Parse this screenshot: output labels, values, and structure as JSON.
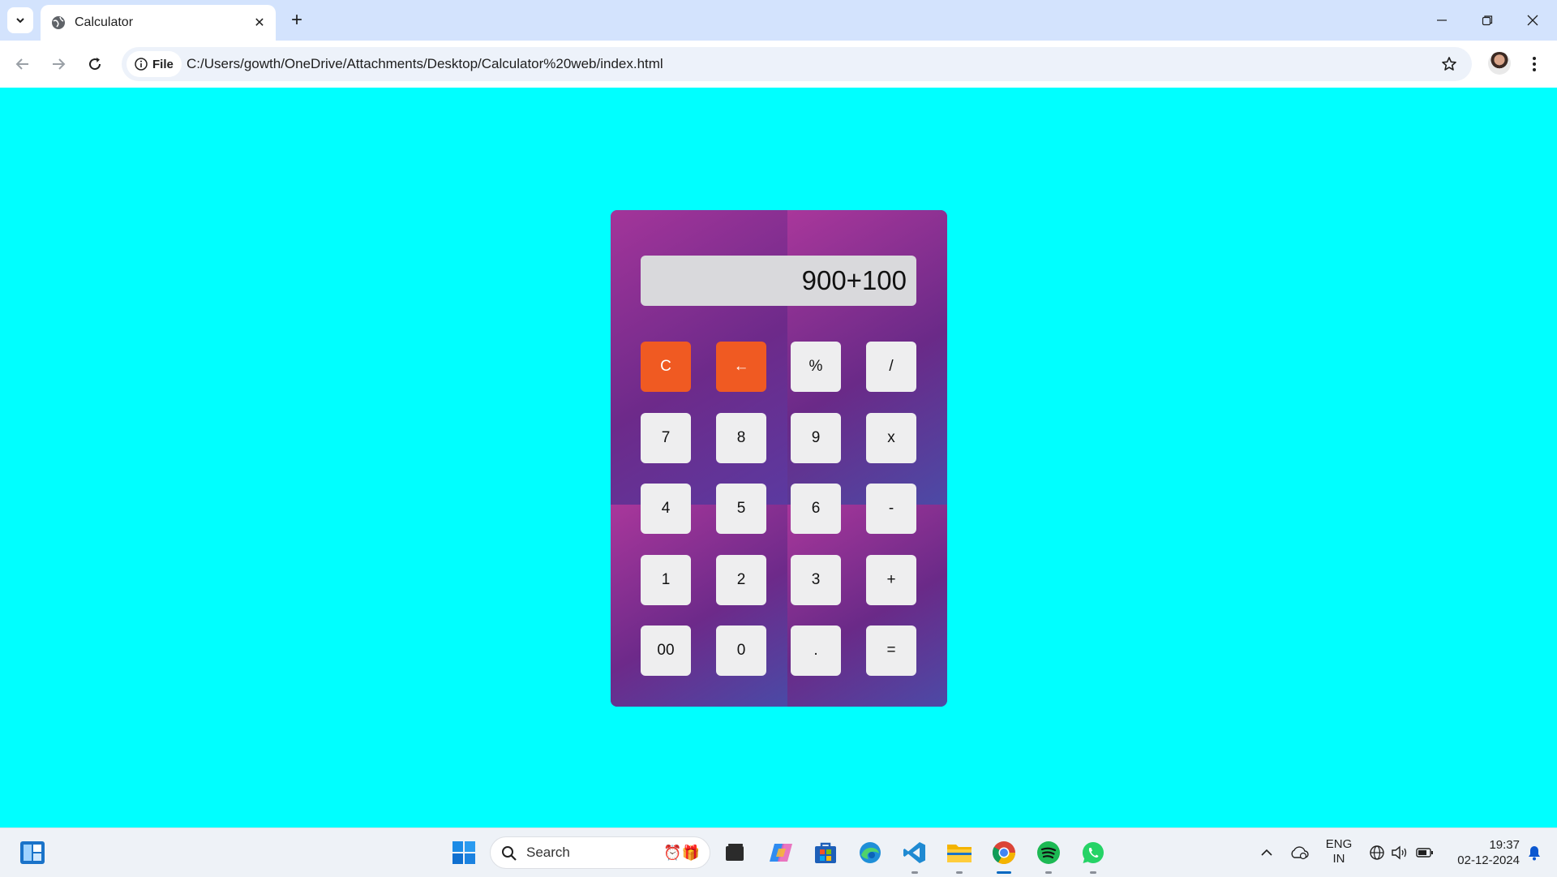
{
  "browser": {
    "tab_title": "Calculator",
    "url_chip_label": "File",
    "url": "C:/Users/gowth/OneDrive/Attachments/Desktop/Calculator%20web/index.html"
  },
  "calculator": {
    "display": "900+100",
    "keys": [
      "C",
      "←",
      "%",
      "/",
      "7",
      "8",
      "9",
      "x",
      "4",
      "5",
      "6",
      "-",
      "1",
      "2",
      "3",
      "+",
      "00",
      "0",
      ".",
      "="
    ]
  },
  "taskbar": {
    "search_placeholder": "Search",
    "language_line1": "ENG",
    "language_line2": "IN",
    "time": "19:37",
    "date": "02-12-2024"
  },
  "colors": {
    "page_background": "#00ffff",
    "accent_key": "#f05a22",
    "calculator_body": "#7a2d92"
  }
}
